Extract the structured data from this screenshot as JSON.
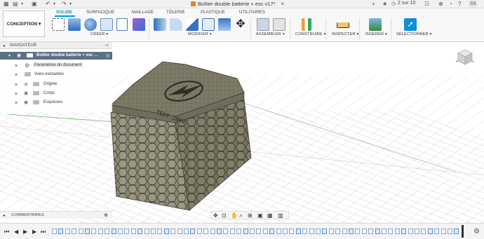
{
  "window": {
    "title": "Boîtier double batterie + esc v17*",
    "pager": "2 sur 10",
    "user_initials": "SS"
  },
  "workspace": {
    "label": "CONCEPTION ▾"
  },
  "tabs": [
    {
      "label": "SOLIDE",
      "active": true
    },
    {
      "label": "SURFACIQUE",
      "active": false
    },
    {
      "label": "MAILLAGE",
      "active": false
    },
    {
      "label": "TÔLERIE",
      "active": false
    },
    {
      "label": "PLASTIQUE",
      "active": false
    },
    {
      "label": "UTILITAIRES",
      "active": false
    }
  ],
  "groups": [
    {
      "label": "CRÉER ▾"
    },
    {
      "label": "MODIFIER ▾"
    },
    {
      "label": "ASSEMBLER ▾"
    },
    {
      "label": "CONSTRUIRE ▾"
    },
    {
      "label": "INSPECTER ▾"
    },
    {
      "label": "INSÉRER ▾"
    },
    {
      "label": "SÉLECTIONNER ▾"
    }
  ],
  "browser": {
    "header": "NAVIGATEUR",
    "root": "Boîtier double batterie + esc ...",
    "items": [
      {
        "label": "Paramètres du document"
      },
      {
        "label": "Vues existantes"
      },
      {
        "label": "Origine"
      },
      {
        "label": "Corps"
      },
      {
        "label": "Esquisses"
      }
    ]
  },
  "comments": {
    "label": "COMMENTAIRES"
  },
  "model": {
    "engraving": "TEXT 2000"
  },
  "colors": {
    "accent": "#0696d7",
    "root_row": "#5c6f86",
    "model_body": "#8b8874",
    "model_top": "#7d7a68"
  },
  "icons": {
    "save": "save-icon",
    "undo": "undo-icon",
    "redo": "redo-icon",
    "view_cube": "view-cube-icon",
    "timeline_settings": "gear-icon"
  }
}
